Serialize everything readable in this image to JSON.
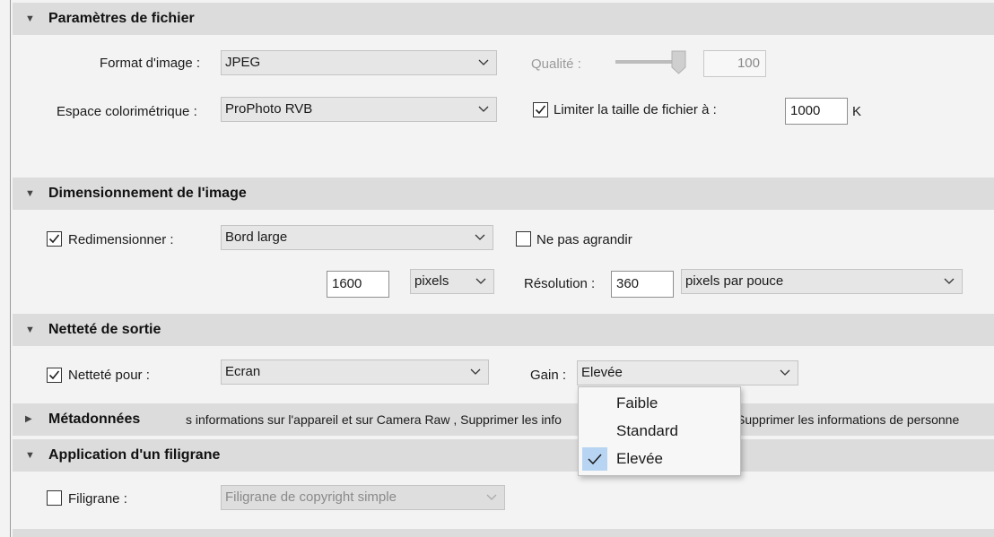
{
  "sections": {
    "file_settings": {
      "title": "Paramètres de fichier"
    },
    "image_sizing": {
      "title": "Dimensionnement de l'image"
    },
    "output_sharpening": {
      "title": "Netteté de sortie"
    },
    "metadata": {
      "title": "Métadonnées",
      "summary": "s informations sur l'appareil et sur Camera Raw , Supprimer les info",
      "summary_right": "Supprimer les informations de personne"
    },
    "watermark": {
      "title": "Application d'un filigrane"
    }
  },
  "file_settings": {
    "format_label": "Format d'image :",
    "format_value": "JPEG",
    "quality_label": "Qualité :",
    "quality_value": "100",
    "colorspace_label": "Espace colorimétrique :",
    "colorspace_value": "ProPhoto RVB",
    "limit_label": "Limiter la taille de fichier à :",
    "limit_checked": true,
    "limit_value": "1000",
    "limit_unit": "K"
  },
  "image_sizing": {
    "resize_label": "Redimensionner :",
    "resize_checked": true,
    "resize_mode": "Bord large",
    "no_enlarge_label": "Ne pas agrandir",
    "no_enlarge_checked": false,
    "size_value": "1600",
    "size_unit": "pixels",
    "resolution_label": "Résolution :",
    "resolution_value": "360",
    "resolution_unit": "pixels par pouce"
  },
  "output_sharpening": {
    "sharpen_label": "Netteté pour :",
    "sharpen_checked": true,
    "sharpen_for": "Ecran",
    "gain_label": "Gain :",
    "gain_value": "Elevée",
    "gain_options": [
      "Faible",
      "Standard",
      "Elevée"
    ],
    "gain_selected": "Elevée"
  },
  "watermark": {
    "watermark_label": "Filigrane :",
    "watermark_checked": false,
    "watermark_value": "Filigrane de copyright simple"
  },
  "colors": {
    "header_bg": "#dcdcdc",
    "panel_bg": "#f3f3f3",
    "menu_check_bg": "#b7d5f2"
  }
}
